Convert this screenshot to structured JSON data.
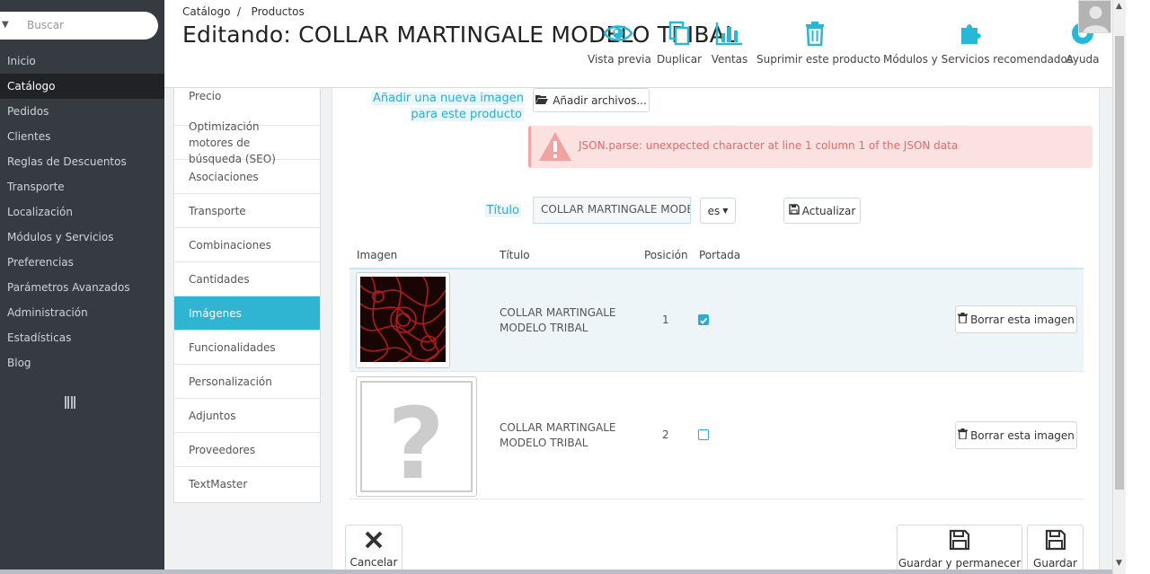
{
  "sidebar": {
    "search_placeholder": "Buscar",
    "items": [
      {
        "label": "Inicio"
      },
      {
        "label": "Catálogo",
        "active": true
      },
      {
        "label": "Pedidos"
      },
      {
        "label": "Clientes"
      },
      {
        "label": "Reglas de Descuentos"
      },
      {
        "label": "Transporte"
      },
      {
        "label": "Localización"
      },
      {
        "label": "Módulos y Servicios"
      },
      {
        "label": "Preferencias"
      },
      {
        "label": "Parámetros Avanzados"
      },
      {
        "label": "Administración"
      },
      {
        "label": "Estadísticas"
      },
      {
        "label": "Blog"
      }
    ]
  },
  "header": {
    "breadcrumb": "Catálogo  /   Productos",
    "title": "Editando: COLLAR MARTINGALE MODELO TRIBAL",
    "toolbar": {
      "preview": "Vista previa",
      "duplicate": "Duplicar",
      "sales": "Ventas",
      "delete": "Suprimir este producto",
      "modules": "Módulos y Servicios recomendados",
      "help": "Ayuda"
    }
  },
  "tabs": [
    {
      "label": "Precio"
    },
    {
      "label": "Optimización motores de búsqueda (SEO)"
    },
    {
      "label": "Asociaciones"
    },
    {
      "label": "Transporte"
    },
    {
      "label": "Combinaciones"
    },
    {
      "label": "Cantidades"
    },
    {
      "label": "Imágenes",
      "active": true
    },
    {
      "label": "Funcionalidades"
    },
    {
      "label": "Personalización"
    },
    {
      "label": "Adjuntos"
    },
    {
      "label": "Proveedores"
    },
    {
      "label": "TextMaster"
    }
  ],
  "images_panel": {
    "add_label": "Añadir una nueva imagen para este producto",
    "add_button": "Añadir archivos...",
    "error": "JSON.parse: unexpected character at line 1 column 1 of the JSON data",
    "title_label": "Título",
    "title_value": "COLLAR MARTINGALE MODELO TRIBAL",
    "lang": "es",
    "update_button": "Actualizar",
    "columns": {
      "image": "Imagen",
      "title": "Título",
      "position": "Posición",
      "cover": "Portada"
    },
    "rows": [
      {
        "title": "COLLAR MARTINGALE MODELO TRIBAL",
        "position": "1",
        "cover": true,
        "delete": "Borrar esta imagen"
      },
      {
        "title": "COLLAR MARTINGALE MODELO TRIBAL",
        "position": "2",
        "cover": false,
        "delete": "Borrar esta imagen"
      }
    ]
  },
  "footer": {
    "cancel": "Cancelar",
    "save_stay": "Guardar y permanecer",
    "save": "Guardar"
  },
  "colors": {
    "sidebar": "#363a41",
    "accent": "#2fb5d2",
    "error_bg": "#fbe1e0",
    "error_text": "#e36a6a"
  }
}
